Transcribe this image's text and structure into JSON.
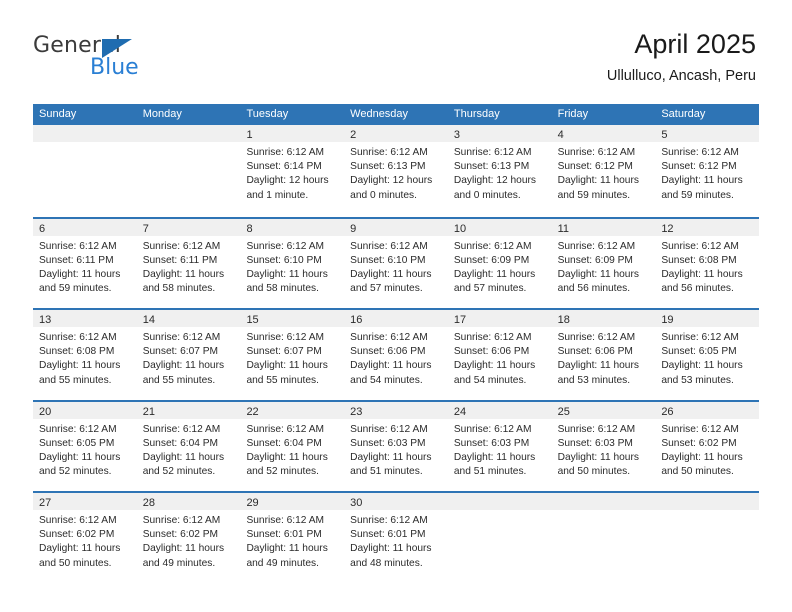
{
  "brand": {
    "name_top": "General",
    "name_bottom": "Blue",
    "accent_color": "#2a7fd4",
    "triangle_color": "#1f6cb0"
  },
  "header": {
    "title": "April 2025",
    "subtitle": "Ullulluco, Ancash, Peru"
  },
  "calendar": {
    "header_bg": "#2e74b5",
    "day_band_bg": "#f0f0f0",
    "weekdays": [
      "Sunday",
      "Monday",
      "Tuesday",
      "Wednesday",
      "Thursday",
      "Friday",
      "Saturday"
    ],
    "weeks": [
      [
        {
          "day": "",
          "lines": []
        },
        {
          "day": "",
          "lines": []
        },
        {
          "day": "1",
          "lines": [
            "Sunrise: 6:12 AM",
            "Sunset: 6:14 PM",
            "Daylight: 12 hours",
            "and 1 minute."
          ]
        },
        {
          "day": "2",
          "lines": [
            "Sunrise: 6:12 AM",
            "Sunset: 6:13 PM",
            "Daylight: 12 hours",
            "and 0 minutes."
          ]
        },
        {
          "day": "3",
          "lines": [
            "Sunrise: 6:12 AM",
            "Sunset: 6:13 PM",
            "Daylight: 12 hours",
            "and 0 minutes."
          ]
        },
        {
          "day": "4",
          "lines": [
            "Sunrise: 6:12 AM",
            "Sunset: 6:12 PM",
            "Daylight: 11 hours",
            "and 59 minutes."
          ]
        },
        {
          "day": "5",
          "lines": [
            "Sunrise: 6:12 AM",
            "Sunset: 6:12 PM",
            "Daylight: 11 hours",
            "and 59 minutes."
          ]
        }
      ],
      [
        {
          "day": "6",
          "lines": [
            "Sunrise: 6:12 AM",
            "Sunset: 6:11 PM",
            "Daylight: 11 hours",
            "and 59 minutes."
          ]
        },
        {
          "day": "7",
          "lines": [
            "Sunrise: 6:12 AM",
            "Sunset: 6:11 PM",
            "Daylight: 11 hours",
            "and 58 minutes."
          ]
        },
        {
          "day": "8",
          "lines": [
            "Sunrise: 6:12 AM",
            "Sunset: 6:10 PM",
            "Daylight: 11 hours",
            "and 58 minutes."
          ]
        },
        {
          "day": "9",
          "lines": [
            "Sunrise: 6:12 AM",
            "Sunset: 6:10 PM",
            "Daylight: 11 hours",
            "and 57 minutes."
          ]
        },
        {
          "day": "10",
          "lines": [
            "Sunrise: 6:12 AM",
            "Sunset: 6:09 PM",
            "Daylight: 11 hours",
            "and 57 minutes."
          ]
        },
        {
          "day": "11",
          "lines": [
            "Sunrise: 6:12 AM",
            "Sunset: 6:09 PM",
            "Daylight: 11 hours",
            "and 56 minutes."
          ]
        },
        {
          "day": "12",
          "lines": [
            "Sunrise: 6:12 AM",
            "Sunset: 6:08 PM",
            "Daylight: 11 hours",
            "and 56 minutes."
          ]
        }
      ],
      [
        {
          "day": "13",
          "lines": [
            "Sunrise: 6:12 AM",
            "Sunset: 6:08 PM",
            "Daylight: 11 hours",
            "and 55 minutes."
          ]
        },
        {
          "day": "14",
          "lines": [
            "Sunrise: 6:12 AM",
            "Sunset: 6:07 PM",
            "Daylight: 11 hours",
            "and 55 minutes."
          ]
        },
        {
          "day": "15",
          "lines": [
            "Sunrise: 6:12 AM",
            "Sunset: 6:07 PM",
            "Daylight: 11 hours",
            "and 55 minutes."
          ]
        },
        {
          "day": "16",
          "lines": [
            "Sunrise: 6:12 AM",
            "Sunset: 6:06 PM",
            "Daylight: 11 hours",
            "and 54 minutes."
          ]
        },
        {
          "day": "17",
          "lines": [
            "Sunrise: 6:12 AM",
            "Sunset: 6:06 PM",
            "Daylight: 11 hours",
            "and 54 minutes."
          ]
        },
        {
          "day": "18",
          "lines": [
            "Sunrise: 6:12 AM",
            "Sunset: 6:06 PM",
            "Daylight: 11 hours",
            "and 53 minutes."
          ]
        },
        {
          "day": "19",
          "lines": [
            "Sunrise: 6:12 AM",
            "Sunset: 6:05 PM",
            "Daylight: 11 hours",
            "and 53 minutes."
          ]
        }
      ],
      [
        {
          "day": "20",
          "lines": [
            "Sunrise: 6:12 AM",
            "Sunset: 6:05 PM",
            "Daylight: 11 hours",
            "and 52 minutes."
          ]
        },
        {
          "day": "21",
          "lines": [
            "Sunrise: 6:12 AM",
            "Sunset: 6:04 PM",
            "Daylight: 11 hours",
            "and 52 minutes."
          ]
        },
        {
          "day": "22",
          "lines": [
            "Sunrise: 6:12 AM",
            "Sunset: 6:04 PM",
            "Daylight: 11 hours",
            "and 52 minutes."
          ]
        },
        {
          "day": "23",
          "lines": [
            "Sunrise: 6:12 AM",
            "Sunset: 6:03 PM",
            "Daylight: 11 hours",
            "and 51 minutes."
          ]
        },
        {
          "day": "24",
          "lines": [
            "Sunrise: 6:12 AM",
            "Sunset: 6:03 PM",
            "Daylight: 11 hours",
            "and 51 minutes."
          ]
        },
        {
          "day": "25",
          "lines": [
            "Sunrise: 6:12 AM",
            "Sunset: 6:03 PM",
            "Daylight: 11 hours",
            "and 50 minutes."
          ]
        },
        {
          "day": "26",
          "lines": [
            "Sunrise: 6:12 AM",
            "Sunset: 6:02 PM",
            "Daylight: 11 hours",
            "and 50 minutes."
          ]
        }
      ],
      [
        {
          "day": "27",
          "lines": [
            "Sunrise: 6:12 AM",
            "Sunset: 6:02 PM",
            "Daylight: 11 hours",
            "and 50 minutes."
          ]
        },
        {
          "day": "28",
          "lines": [
            "Sunrise: 6:12 AM",
            "Sunset: 6:02 PM",
            "Daylight: 11 hours",
            "and 49 minutes."
          ]
        },
        {
          "day": "29",
          "lines": [
            "Sunrise: 6:12 AM",
            "Sunset: 6:01 PM",
            "Daylight: 11 hours",
            "and 49 minutes."
          ]
        },
        {
          "day": "30",
          "lines": [
            "Sunrise: 6:12 AM",
            "Sunset: 6:01 PM",
            "Daylight: 11 hours",
            "and 48 minutes."
          ]
        },
        {
          "day": "",
          "lines": []
        },
        {
          "day": "",
          "lines": []
        },
        {
          "day": "",
          "lines": []
        }
      ]
    ]
  }
}
